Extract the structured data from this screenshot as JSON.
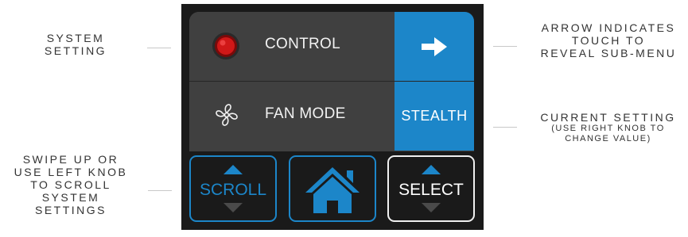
{
  "annotations": {
    "system_setting": [
      "SYSTEM",
      "SETTING"
    ],
    "arrow_note": [
      "ARROW INDICATES",
      "TOUCH TO",
      "REVEAL SUB-MENU"
    ],
    "current_setting": [
      "CURRENT SETTING",
      "(USE RIGHT KNOB TO",
      "CHANGE VALUE)"
    ],
    "swipe_note": [
      "SWIPE UP OR",
      "USE LEFT KNOB",
      "TO SCROLL",
      "SYSTEM",
      "SETTINGS"
    ]
  },
  "menu": {
    "rows": [
      {
        "label": "CONTROL",
        "icon": "red-led-icon",
        "value_icon": "arrow-right-icon"
      },
      {
        "label": "FAN MODE",
        "icon": "fan-icon",
        "value": "STEALTH"
      }
    ]
  },
  "buttons": {
    "scroll": "SCROLL",
    "home_icon": "home-icon",
    "select": "SELECT"
  },
  "colors": {
    "accent_blue": "#1c86c9",
    "panel_gray": "#404040",
    "device_black": "#1a1a1a",
    "led_red": "#d01818",
    "arrow_gray": "#4a4a4a"
  }
}
